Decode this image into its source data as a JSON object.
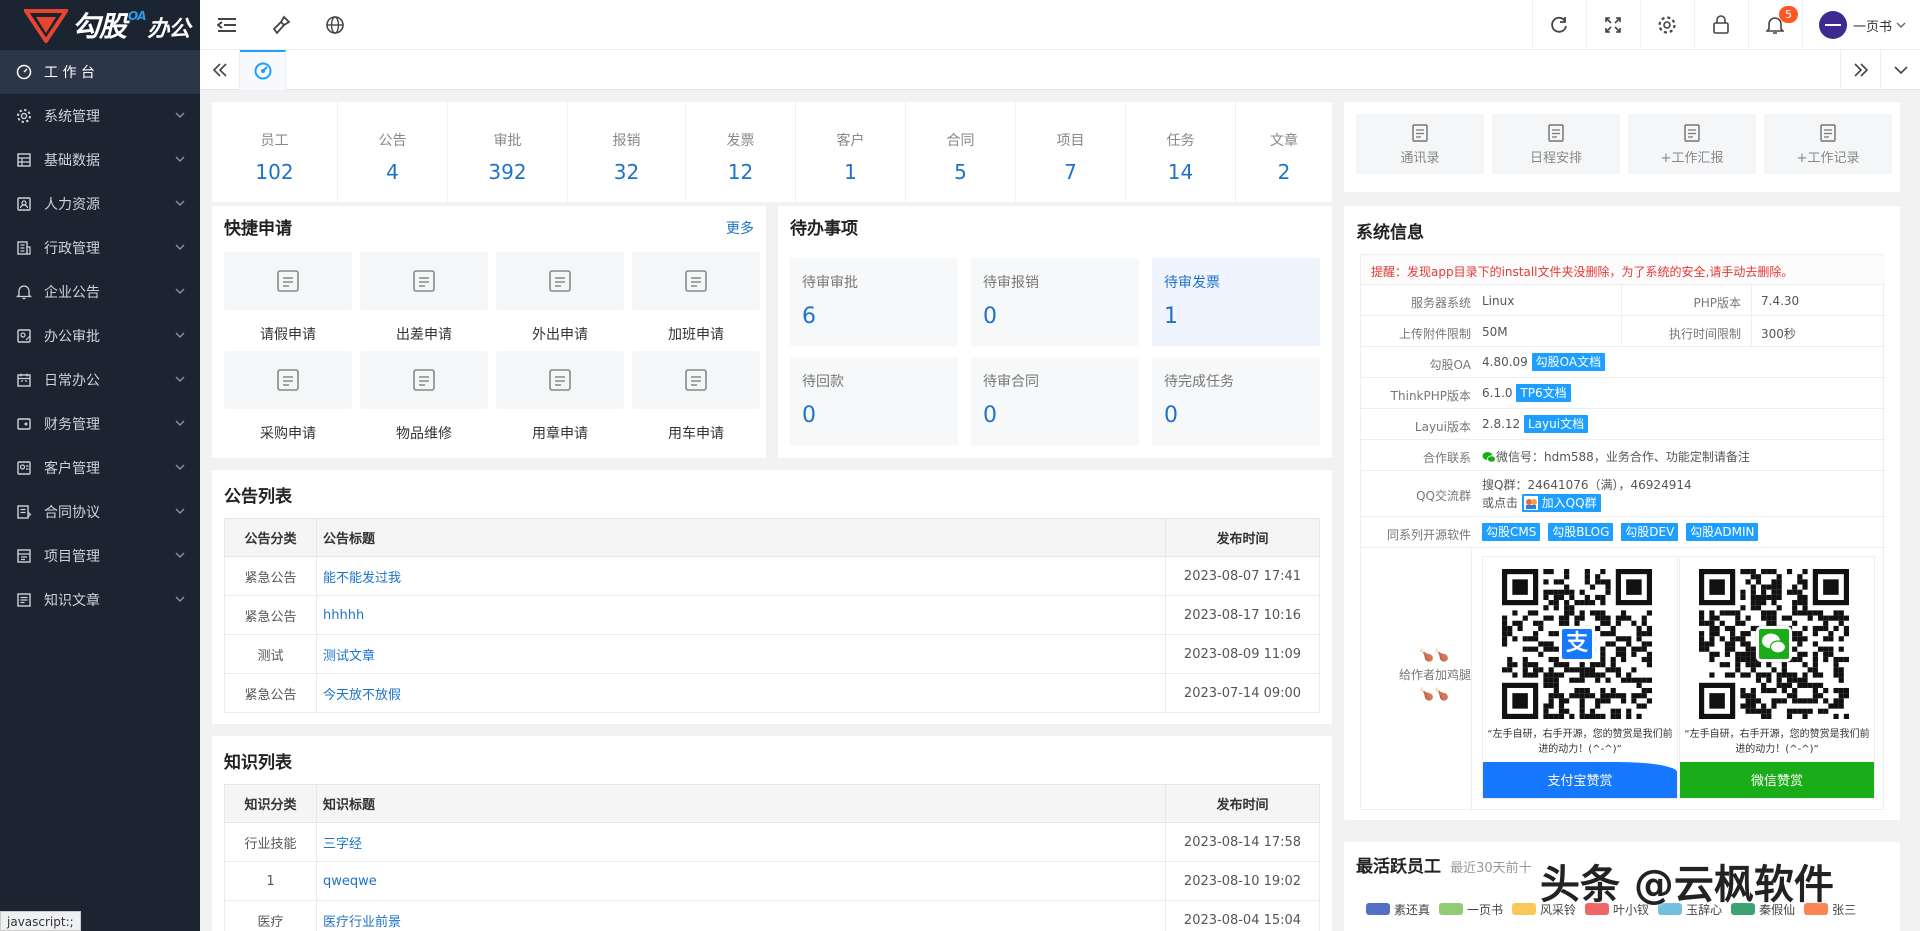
{
  "brand": {
    "logo_text": "勾股",
    "logo_sub": "办公",
    "logo_tag": "OA"
  },
  "colors": {
    "sidebar_bg": "#1b2431",
    "accent": "#1e9fff",
    "link": "#1e73c8",
    "alipay": "#1677ff",
    "wechat": "#1aad19"
  },
  "sidebar": {
    "items": [
      {
        "label": "工 作 台",
        "icon": "dashboard-icon"
      },
      {
        "label": "系统管理",
        "icon": "gear-icon"
      },
      {
        "label": "基础数据",
        "icon": "grid-icon"
      },
      {
        "label": "人力资源",
        "icon": "user-card-icon"
      },
      {
        "label": "行政管理",
        "icon": "building-icon"
      },
      {
        "label": "企业公告",
        "icon": "bell-icon"
      },
      {
        "label": "办公审批",
        "icon": "approval-icon"
      },
      {
        "label": "日常办公",
        "icon": "calendar-icon"
      },
      {
        "label": "财务管理",
        "icon": "finance-icon"
      },
      {
        "label": "客户管理",
        "icon": "customer-icon"
      },
      {
        "label": "合同协议",
        "icon": "contract-icon"
      },
      {
        "label": "项目管理",
        "icon": "project-icon"
      },
      {
        "label": "知识文章",
        "icon": "article-icon"
      }
    ]
  },
  "statusbar": {
    "text": "javascript:;"
  },
  "header": {
    "user_name": "一页书",
    "notification_count": "5"
  },
  "stats": [
    {
      "label": "员工",
      "value": "102"
    },
    {
      "label": "公告",
      "value": "4"
    },
    {
      "label": "审批",
      "value": "392"
    },
    {
      "label": "报销",
      "value": "32"
    },
    {
      "label": "发票",
      "value": "12"
    },
    {
      "label": "客户",
      "value": "1"
    },
    {
      "label": "合同",
      "value": "5"
    },
    {
      "label": "项目",
      "value": "7"
    },
    {
      "label": "任务",
      "value": "14"
    },
    {
      "label": "文章",
      "value": "2"
    }
  ],
  "shortcuts": [
    {
      "label": "通讯录"
    },
    {
      "label": "日程安排"
    },
    {
      "label": "+工作汇报"
    },
    {
      "label": "+工作记录"
    }
  ],
  "quick": {
    "title": "快捷申请",
    "more": "更多",
    "items": [
      {
        "label": "请假申请"
      },
      {
        "label": "出差申请"
      },
      {
        "label": "外出申请"
      },
      {
        "label": "加班申请"
      },
      {
        "label": "采购申请"
      },
      {
        "label": "物品维修"
      },
      {
        "label": "用章申请"
      },
      {
        "label": "用车申请"
      }
    ]
  },
  "todo": {
    "title": "待办事项",
    "items": [
      {
        "label": "待审审批",
        "value": "6"
      },
      {
        "label": "待审报销",
        "value": "0"
      },
      {
        "label": "待审发票",
        "value": "1"
      },
      {
        "label": "待回款",
        "value": "0"
      },
      {
        "label": "待审合同",
        "value": "0"
      },
      {
        "label": "待完成任务",
        "value": "0"
      }
    ]
  },
  "notices": {
    "title": "公告列表",
    "columns": [
      "公告分类",
      "公告标题",
      "发布时间"
    ],
    "rows": [
      {
        "cat": "紧急公告",
        "title": "能不能发过我",
        "time": "2023-08-07 17:41"
      },
      {
        "cat": "紧急公告",
        "title": "hhhhh",
        "time": "2023-08-17 10:16"
      },
      {
        "cat": "测试",
        "title": "测试文章",
        "time": "2023-08-09 11:09"
      },
      {
        "cat": "紧急公告",
        "title": "今天放不放假",
        "time": "2023-07-14 09:00"
      }
    ]
  },
  "knowledge": {
    "title": "知识列表",
    "columns": [
      "知识分类",
      "知识标题",
      "发布时间"
    ],
    "rows": [
      {
        "cat": "行业技能",
        "title": "三字经",
        "time": "2023-08-14 17:58"
      },
      {
        "cat": "1",
        "title": "qweqwe",
        "time": "2023-08-10 19:02"
      },
      {
        "cat": "医疗",
        "title": "医疗行业前景",
        "time": "2023-08-04 15:04"
      }
    ]
  },
  "sysinfo": {
    "title": "系统信息",
    "warning": "提醒：发现app目录下的install文件夹没删除，为了系统的安全,请手动去删除。",
    "os_label": "服务器系统",
    "os": "Linux",
    "php_label": "PHP版本",
    "php": "7.4.30",
    "upload_label": "上传附件限制",
    "upload": "50M",
    "exec_label": "执行时间限制",
    "exec": "300秒",
    "oa_label": "勾股OA",
    "oa": "4.80.09",
    "oa_doc": "勾股OA文档",
    "tp_label": "ThinkPHP版本",
    "tp": "6.1.0",
    "tp_doc": "TP6文档",
    "layui_label": "Layui版本",
    "layui": "2.8.12",
    "layui_doc": "Layui文档",
    "contact_label": "合作联系",
    "contact": "微信号：hdm588，业务合作、功能定制请备注",
    "qq_label": "QQ交流群",
    "qq_line1": "搜Q群：24641076（满），46924914",
    "qq_line2": "或点击",
    "qq_join": "加入QQ群",
    "oss_label": "同系列开源软件",
    "oss": [
      "勾股CMS",
      "勾股BLOG",
      "勾股DEV",
      "勾股ADMIN"
    ],
    "donate_label": "给作者加鸡腿",
    "qr_caption": "“左手自研，右手开源，您的赞赏是我们前进的动力！(^-^)”",
    "alipay_label": "支付宝赞赏",
    "wechat_label": "微信赞赏"
  },
  "active": {
    "title": "最活跃员工",
    "subtitle": "最近30天前十",
    "legend": [
      {
        "name": "素还真",
        "color": "#5470c6"
      },
      {
        "name": "一页书",
        "color": "#91cc75"
      },
      {
        "name": "风采铃",
        "color": "#fac858"
      },
      {
        "name": "叶小钗",
        "color": "#ee6666"
      },
      {
        "name": "玉辞心",
        "color": "#73c0de"
      },
      {
        "name": "秦假仙",
        "color": "#3ba272"
      },
      {
        "name": "张三",
        "color": "#fc8452"
      }
    ]
  },
  "watermark": "头条 @云枫软件"
}
